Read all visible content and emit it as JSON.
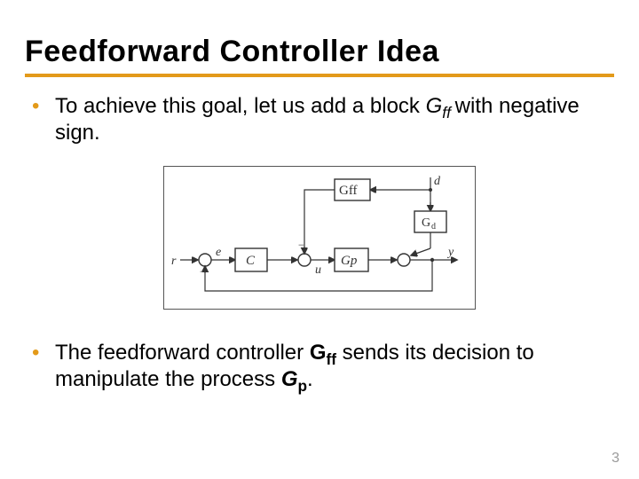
{
  "title": "Feedforward Controller Idea",
  "bullet1": {
    "t1": "To achieve this goal, let us add a block ",
    "Gff": "G",
    "Gff_sub": "ff ",
    "t2": "with negative sign."
  },
  "bullet2": {
    "t1": "The feedforward controller ",
    "Gff": "G",
    "Gff_sub": "ff",
    "t2": " sends its decision to manipulate the process ",
    "Gp": "G",
    "Gp_sub": "p",
    "t3": "."
  },
  "diagram": {
    "blocks": {
      "C": "C",
      "Gp": "Gp",
      "Gff": "Gff",
      "Gd_G": "G",
      "Gd_d": "d"
    },
    "signals": {
      "r": "r",
      "e": "e",
      "u": "u",
      "d": "d",
      "y": "y"
    },
    "minus": "−"
  },
  "pagenum": "3"
}
